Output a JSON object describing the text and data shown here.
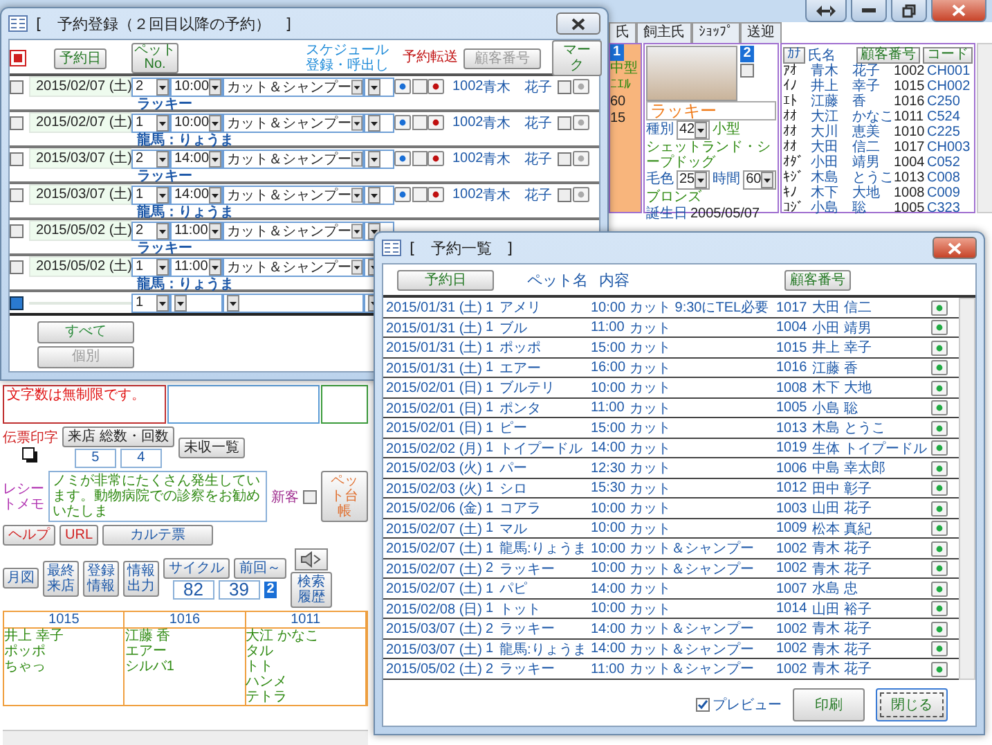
{
  "main_window": {
    "tabs": [
      {
        "label": "氏",
        "selected": false
      },
      {
        "label": "飼主氏",
        "selected": false
      },
      {
        "label": "ｼｮｯﾌﾟ",
        "selected": false
      },
      {
        "label": "送迎",
        "selected": false
      }
    ],
    "side_pet_panel": {
      "badge": "1",
      "size": "中型",
      "breed": "ﾆｴﾙ",
      "time": "60",
      "birthday": "15"
    },
    "pet_panel": {
      "badge": "2",
      "name": "ラッキー",
      "type_label": "種別",
      "type": "42",
      "size": "小型",
      "breed": "シェットランド・シープドッグ",
      "coat_label": "毛色",
      "coat_no": "25",
      "time_label": "時間",
      "time": "60",
      "coat_name": "ブロンズ",
      "remove_checked": false,
      "birthday_label": "誕生日",
      "birthday": "2005/05/07"
    },
    "customer_list": {
      "kana_button": "ｶﾅ",
      "name_label": "氏名",
      "buttons": [
        "顧客番号",
        "コード"
      ],
      "rows": [
        {
          "kana": "ｱｵ",
          "name": "青木　花子",
          "number": "1002",
          "code": "CH001"
        },
        {
          "kana": "ｲﾉ",
          "name": "井上　幸子",
          "number": "1015",
          "code": "CH002"
        },
        {
          "kana": "ｴﾄ",
          "name": "江藤　香",
          "number": "1016",
          "code": "C250"
        },
        {
          "kana": "ｵｵ",
          "name": "大江　かなこ",
          "number": "1011",
          "code": "C524"
        },
        {
          "kana": "ｵｵ",
          "name": "大川　恵美",
          "number": "1010",
          "code": "C225"
        },
        {
          "kana": "ｵｵ",
          "name": "大田　信二",
          "number": "1017",
          "code": "CH003"
        },
        {
          "kana": "ｵﾀﾞ",
          "name": "小田　靖男",
          "number": "1004",
          "code": "C052"
        },
        {
          "kana": "ｷｼﾞ",
          "name": "木島　とうこ",
          "number": "1013",
          "code": "C008"
        },
        {
          "kana": "ｷﾉ",
          "name": "木下　大地",
          "number": "1008",
          "code": "C009"
        },
        {
          "kana": "ｺｼﾞ",
          "name": "小島　聡",
          "number": "1005",
          "code": "C323"
        }
      ]
    },
    "bottom_panel": {
      "memo": "文字数は無制限です。",
      "slip_label": "伝票印字",
      "visit_button": "来店 総数・回数",
      "visit_total": "5",
      "visit_count": "4",
      "unpaid_button": "未収一覧",
      "receipt_label": "レシートメモ",
      "receipt_memo": "ノミが非常にたくさん発生しています。動物病院での診察をお勧めいたしま",
      "new_customer": {
        "label": "新客",
        "checked": false
      },
      "pet_ledger_button": "ペット台帳",
      "help_button": "ヘルプ",
      "url_button": "URL",
      "chart_button": "カルテ票",
      "side_buttons": [
        "月図",
        "最終来店",
        "登録情報",
        "情報出力"
      ],
      "cycle_label": "サイクル",
      "last_label": "前回～",
      "cycle": "82",
      "last": "39",
      "badge": "2",
      "history_button": "検索履歴",
      "recent": [
        {
          "number": "1015",
          "name": "井上 幸子",
          "pets": [
            "ポッポ",
            "ちゃっ"
          ]
        },
        {
          "number": "1016",
          "name": "江藤 香",
          "pets": [
            "エアー",
            "シルバ1"
          ]
        },
        {
          "number": "1011",
          "name": "大江 かなこ",
          "pets": [
            "タル",
            "トト",
            "ハンメ",
            "テトラ"
          ]
        }
      ]
    }
  },
  "reservation_form": {
    "title": "[　予約登録（２回目以降の予約）　]",
    "date_button": "予約日",
    "pet_button": "ペット No.",
    "schedule_label_lines": [
      "スケジュール",
      "登録・呼出し"
    ],
    "transfer_label": "予約転送",
    "customer_button": "顧客番号",
    "mark_button": "マーク",
    "rows": [
      {
        "checked": false,
        "date": "2015/02/07 (土)",
        "pet_no": "2",
        "time": "10:00",
        "service": "カット＆シャンプー",
        "customer_no": "1002",
        "customer_name": "青木　花子",
        "mark_checked": false,
        "pet_name": "ラッキー"
      },
      {
        "checked": false,
        "date": "2015/02/07 (土)",
        "pet_no": "1",
        "time": "10:00",
        "service": "カット＆シャンプー",
        "customer_no": "1002",
        "customer_name": "青木　花子",
        "mark_checked": false,
        "pet_name": "龍馬：りょうま"
      },
      {
        "checked": false,
        "date": "2015/03/07 (土)",
        "pet_no": "2",
        "time": "14:00",
        "service": "カット＆シャンプー",
        "customer_no": "1002",
        "customer_name": "青木　花子",
        "mark_checked": false,
        "pet_name": "ラッキー"
      },
      {
        "checked": false,
        "date": "2015/03/07 (土)",
        "pet_no": "1",
        "time": "14:00",
        "service": "カット＆シャンプー",
        "customer_no": "1002",
        "customer_name": "青木　花子",
        "mark_checked": false,
        "pet_name": "龍馬：りょうま"
      },
      {
        "checked": false,
        "date": "2015/05/02 (土)",
        "pet_no": "2",
        "time": "11:00",
        "service": "カット＆シャンプー",
        "pet_name": "ラッキー"
      },
      {
        "checked": false,
        "date": "2015/05/02 (土)",
        "pet_no": "1",
        "time": "11:00",
        "service": "カット＆シャンプー",
        "pet_name": "龍馬：りょうま"
      }
    ],
    "new_row": {
      "pet_no": "1"
    },
    "all_button": "すべて",
    "single_button": "個別"
  },
  "reservation_list": {
    "title": "[　予約一覧　]",
    "date_button": "予約日",
    "pet_label": "ペット名",
    "content_label": "内容",
    "customer_button": "顧客番号",
    "rows": [
      {
        "date": "2015/01/31 (土)",
        "pet_no": "1",
        "pet": "アメリ",
        "time": "10:00",
        "service": "カット 9:30にTEL必要",
        "customer_no": "1017",
        "customer": "大田 信二"
      },
      {
        "date": "2015/01/31 (土)",
        "pet_no": "1",
        "pet": "ブル",
        "time": "11:00",
        "service": "カット",
        "customer_no": "1004",
        "customer": "小田 靖男"
      },
      {
        "date": "2015/01/31 (土)",
        "pet_no": "1",
        "pet": "ポッポ",
        "time": "15:00",
        "service": "カット",
        "customer_no": "1015",
        "customer": "井上 幸子"
      },
      {
        "date": "2015/01/31 (土)",
        "pet_no": "1",
        "pet": "エアー",
        "time": "16:00",
        "service": "カット",
        "customer_no": "1016",
        "customer": "江藤 香"
      },
      {
        "date": "2015/02/01 (日)",
        "pet_no": "1",
        "pet": "ブルテリ",
        "time": "10:00",
        "service": "カット",
        "customer_no": "1008",
        "customer": "木下 大地"
      },
      {
        "date": "2015/02/01 (日)",
        "pet_no": "1",
        "pet": "ポンタ",
        "time": "11:00",
        "service": "カット",
        "customer_no": "1005",
        "customer": "小島 聡"
      },
      {
        "date": "2015/02/01 (日)",
        "pet_no": "1",
        "pet": "ピー",
        "time": "15:00",
        "service": "カット",
        "customer_no": "1013",
        "customer": "木島 とうこ"
      },
      {
        "date": "2015/02/02 (月)",
        "pet_no": "1",
        "pet": "トイプードル",
        "time": "14:00",
        "service": "カット",
        "customer_no": "1019",
        "customer": "生体 トイプードル"
      },
      {
        "date": "2015/02/03 (火)",
        "pet_no": "1",
        "pet": "パー",
        "time": "12:30",
        "service": "カット",
        "customer_no": "1006",
        "customer": "中島 幸太郎"
      },
      {
        "date": "2015/02/03 (火)",
        "pet_no": "1",
        "pet": "シロ",
        "time": "15:30",
        "service": "カット",
        "customer_no": "1012",
        "customer": "田中 彰子"
      },
      {
        "date": "2015/02/06 (金)",
        "pet_no": "1",
        "pet": "コアラ",
        "time": "10:00",
        "service": "カット",
        "customer_no": "1003",
        "customer": "山田 花子"
      },
      {
        "date": "2015/02/07 (土)",
        "pet_no": "1",
        "pet": "マル",
        "time": "10:00",
        "service": "カット",
        "customer_no": "1009",
        "customer": "松本 真紀"
      },
      {
        "date": "2015/02/07 (土)",
        "pet_no": "1",
        "pet": "龍馬:りょうま",
        "time": "10:00",
        "service": "カット＆シャンプー",
        "customer_no": "1002",
        "customer": "青木 花子"
      },
      {
        "date": "2015/02/07 (土)",
        "pet_no": "2",
        "pet": "ラッキー",
        "time": "10:00",
        "service": "カット＆シャンプー",
        "customer_no": "1002",
        "customer": "青木 花子"
      },
      {
        "date": "2015/02/07 (土)",
        "pet_no": "1",
        "pet": "パピ",
        "time": "14:00",
        "service": "カット",
        "customer_no": "1007",
        "customer": "水島 忠"
      },
      {
        "date": "2015/02/08 (日)",
        "pet_no": "1",
        "pet": "トット",
        "time": "10:00",
        "service": "カット",
        "customer_no": "1014",
        "customer": "山田 裕子"
      },
      {
        "date": "2015/03/07 (土)",
        "pet_no": "2",
        "pet": "ラッキー",
        "time": "14:00",
        "service": "カット＆シャンプー",
        "customer_no": "1002",
        "customer": "青木 花子"
      },
      {
        "date": "2015/03/07 (土)",
        "pet_no": "1",
        "pet": "龍馬:りょうま",
        "time": "14:00",
        "service": "カット＆シャンプー",
        "customer_no": "1002",
        "customer": "青木 花子"
      },
      {
        "date": "2015/05/02 (土)",
        "pet_no": "2",
        "pet": "ラッキー",
        "time": "11:00",
        "service": "カット＆シャンプー",
        "customer_no": "1002",
        "customer": "青木 花子"
      }
    ],
    "preview": {
      "label": "プレビュー",
      "checked": true
    },
    "print_button": "印刷",
    "close_button": "閉じる"
  }
}
